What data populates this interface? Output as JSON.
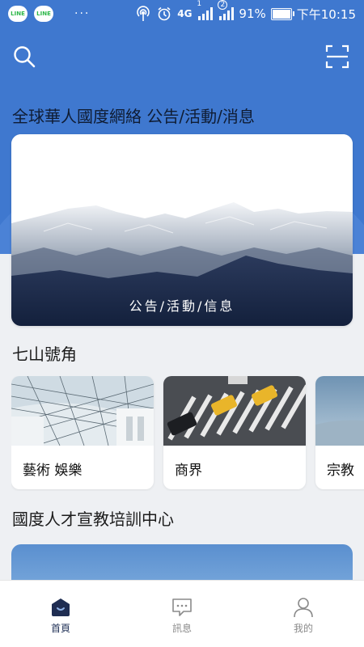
{
  "status_bar": {
    "app_badges": [
      "LINE",
      "LINE"
    ],
    "dots": "···",
    "network_type": "4G",
    "sim_indicator": "1",
    "sim2_indicator": "2",
    "battery_percent": "91%",
    "battery_level": 0.91,
    "time": "下午10:15"
  },
  "header": {
    "search_icon": "search-icon",
    "scan_icon": "scan-icon"
  },
  "announcements": {
    "title": "全球華人國度網絡 公告/活動/消息",
    "banner_caption": "公告/活動/信息"
  },
  "mountains": {
    "title": "七山號角",
    "cards": [
      {
        "label": "藝術 娛樂"
      },
      {
        "label": "商界"
      },
      {
        "label": "宗教"
      }
    ]
  },
  "training": {
    "title": "國度人才宣教培訓中心"
  },
  "tabbar": {
    "tabs": [
      {
        "label": "首頁",
        "icon": "home-icon"
      },
      {
        "label": "訊息",
        "icon": "message-icon"
      },
      {
        "label": "我的",
        "icon": "user-icon"
      }
    ]
  },
  "colors": {
    "primary": "#3f78cf",
    "tab_active": "#24345a",
    "tab_inactive": "#8a8a8a"
  }
}
